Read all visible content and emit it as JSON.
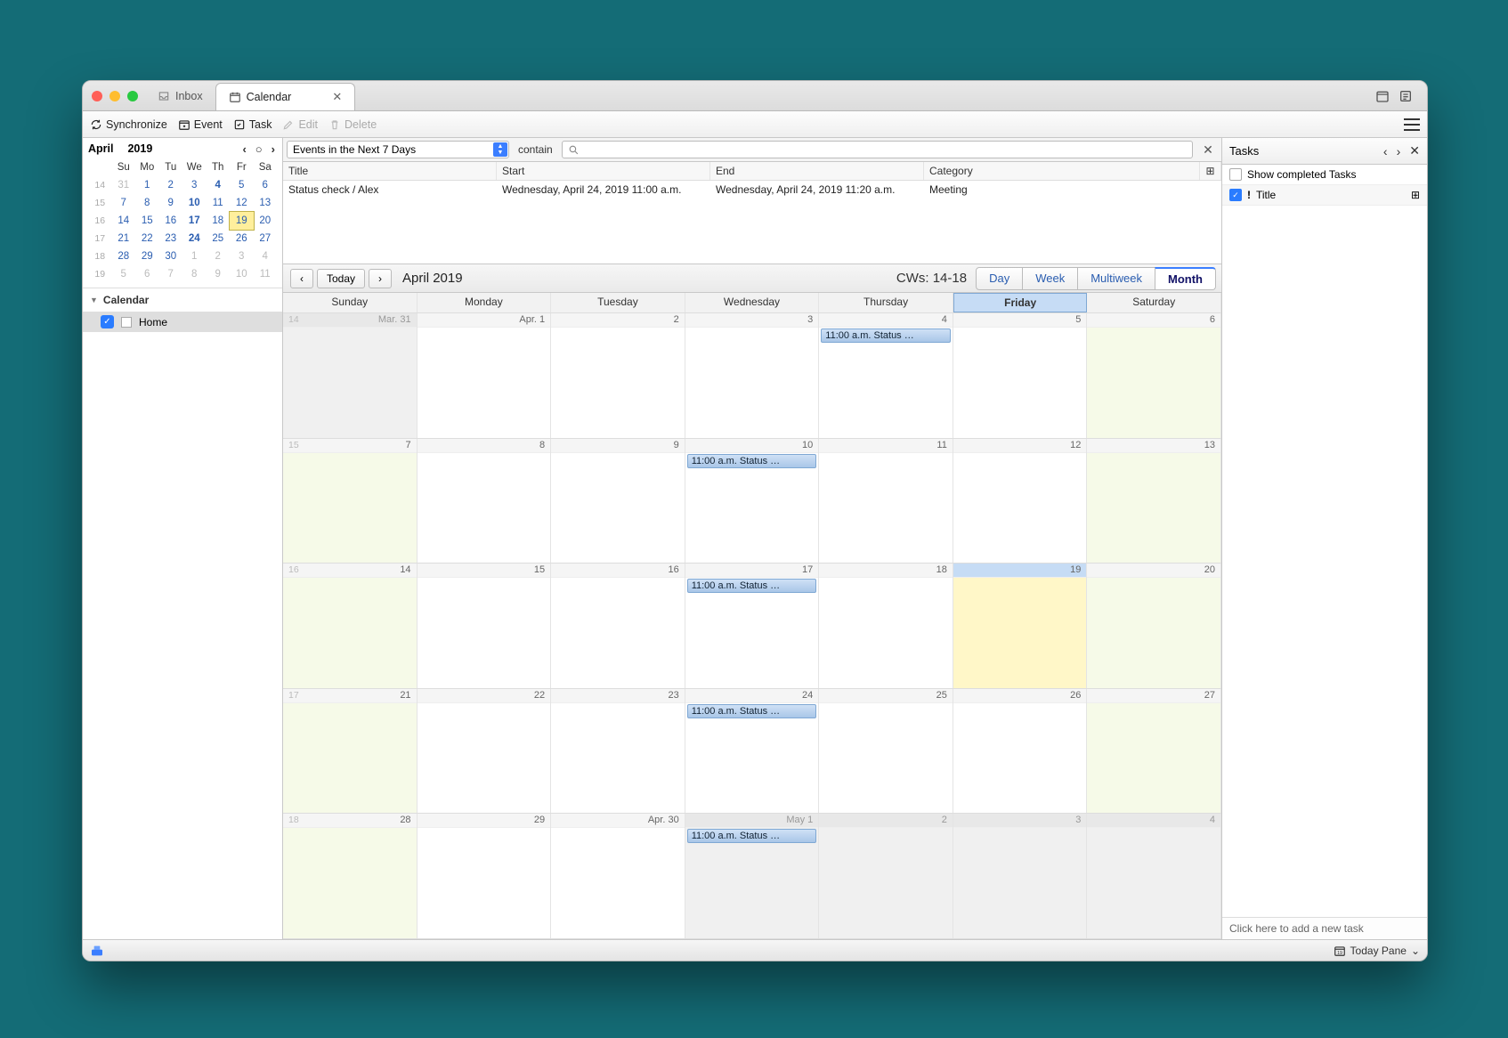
{
  "tabs": {
    "inbox": "Inbox",
    "calendar": "Calendar"
  },
  "toolbar": {
    "sync": "Synchronize",
    "event": "Event",
    "task": "Task",
    "edit": "Edit",
    "delete": "Delete"
  },
  "minical": {
    "month": "April",
    "year": "2019",
    "dow": [
      "Su",
      "Mo",
      "Tu",
      "We",
      "Th",
      "Fr",
      "Sa"
    ],
    "rows": [
      {
        "wk": "14",
        "d": [
          "31",
          "1",
          "2",
          "3",
          "4",
          "5",
          "6"
        ],
        "boldIdx": 4,
        "dimIdx": [
          0
        ]
      },
      {
        "wk": "15",
        "d": [
          "7",
          "8",
          "9",
          "10",
          "11",
          "12",
          "13"
        ],
        "boldIdx": 3
      },
      {
        "wk": "16",
        "d": [
          "14",
          "15",
          "16",
          "17",
          "18",
          "19",
          "20"
        ],
        "boldIdx": 3,
        "todayIdx": 5
      },
      {
        "wk": "17",
        "d": [
          "21",
          "22",
          "23",
          "24",
          "25",
          "26",
          "27"
        ],
        "boldIdx": 3
      },
      {
        "wk": "18",
        "d": [
          "28",
          "29",
          "30",
          "1",
          "2",
          "3",
          "4"
        ],
        "dimIdx": [
          3,
          4,
          5,
          6
        ]
      },
      {
        "wk": "19",
        "d": [
          "5",
          "6",
          "7",
          "8",
          "9",
          "10",
          "11"
        ],
        "dimIdx": [
          0,
          1,
          2,
          3,
          4,
          5,
          6
        ]
      }
    ]
  },
  "sidebar": {
    "section": "Calendar",
    "calendar_name": "Home"
  },
  "filter": {
    "select": "Events in the Next 7 Days",
    "op": "contain"
  },
  "eventlist": {
    "cols": {
      "title": "Title",
      "start": "Start",
      "end": "End",
      "category": "Category"
    },
    "rows": [
      {
        "title": "Status check / Alex",
        "start": "Wednesday, April 24, 2019 11:00 a.m.",
        "end": "Wednesday, April 24, 2019 11:20 a.m.",
        "category": "Meeting"
      }
    ]
  },
  "nav": {
    "today": "Today",
    "title": "April 2019",
    "cws": "CWs: 14-18",
    "views": {
      "day": "Day",
      "week": "Week",
      "multiweek": "Multiweek",
      "month": "Month"
    }
  },
  "dow_full": [
    "Sunday",
    "Monday",
    "Tuesday",
    "Wednesday",
    "Thursday",
    "Friday",
    "Saturday"
  ],
  "month_chip": "11:00 a.m. Status …",
  "month_dates": {
    "r0": [
      "Mar. 31",
      "Apr. 1",
      "2",
      "3",
      "4",
      "5",
      "6"
    ],
    "r1": [
      "7",
      "8",
      "9",
      "10",
      "11",
      "12",
      "13"
    ],
    "r2": [
      "14",
      "15",
      "16",
      "17",
      "18",
      "19",
      "20"
    ],
    "r3": [
      "21",
      "22",
      "23",
      "24",
      "25",
      "26",
      "27"
    ],
    "r4": [
      "28",
      "29",
      "Apr. 30",
      "May 1",
      "2",
      "3",
      "4"
    ]
  },
  "month_wknums": [
    "14",
    "15",
    "16",
    "17",
    "18"
  ],
  "taskspane": {
    "title": "Tasks",
    "show_completed": "Show completed Tasks",
    "col_title": "Title",
    "add_prompt": "Click here to add a new task"
  },
  "status": {
    "today_pane": "Today Pane"
  }
}
